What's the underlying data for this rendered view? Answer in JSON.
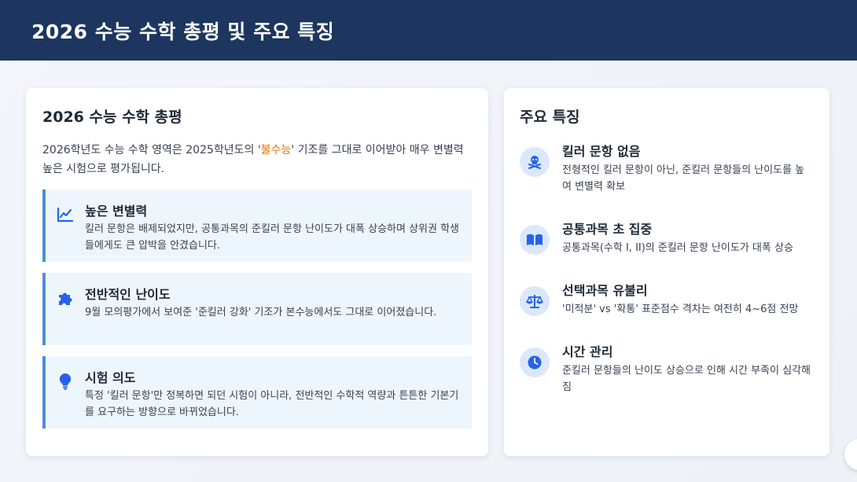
{
  "header": {
    "title": "2026 수능 수학 총평 및 주요 특징"
  },
  "review": {
    "title": "2026 수능 수학 총평",
    "intro_before": "2026학년도 수능 수학 영역은 2025학년도의 '",
    "intro_highlight": "불수능",
    "intro_after": "' 기조를 그대로 이어받아 매우 변별력 높은 시험으로 평가됩니다.",
    "features": [
      {
        "icon": "chart-line-icon",
        "title": "높은 변별력",
        "desc": "킬러 문항은 배제되었지만, 공통과목의 준킬러 문항 난이도가 대폭 상승하며 상위권 학생들에게도 큰 압박을 안겼습니다."
      },
      {
        "icon": "puzzle-icon",
        "title": "전반적인 난이도",
        "desc": "9월 모의평가에서 보여준 '준킬러 강화' 기조가 본수능에서도 그대로 이어졌습니다."
      },
      {
        "icon": "lightbulb-icon",
        "title": "시험 의도",
        "desc": "특정 '킬러 문항'만 정복하면 되던 시험이 아니라, 전반적인 수학적 역량과 튼튼한 기본기를 요구하는 방향으로 바뀌었습니다."
      }
    ]
  },
  "points": {
    "title": "주요 특징",
    "items": [
      {
        "icon": "skull-crossbones-icon",
        "title": "킬러 문항 없음",
        "desc": "전형적인 킬러 문항이 아닌, 준킬러 문항들의 난이도를 높여 변별력 확보"
      },
      {
        "icon": "book-open-icon",
        "title": "공통과목 초 집중",
        "desc": "공통과목(수학 I, II)의 준킬러 문항 난이도가 대폭 상승"
      },
      {
        "icon": "balance-scale-icon",
        "title": "선택과목 유불리",
        "desc": "'미적분' vs '확통' 표준점수 격차는 여전히 4~6점 전망"
      },
      {
        "icon": "clock-icon",
        "title": "시간 관리",
        "desc": "준킬러 문항들의 난이도 상승으로 인해 시간 부족이 심각해짐"
      }
    ]
  },
  "colors": {
    "header_bg": "#1c3660",
    "accent": "#4a90d9",
    "highlight": "#d97706",
    "icon": "#2563eb"
  }
}
